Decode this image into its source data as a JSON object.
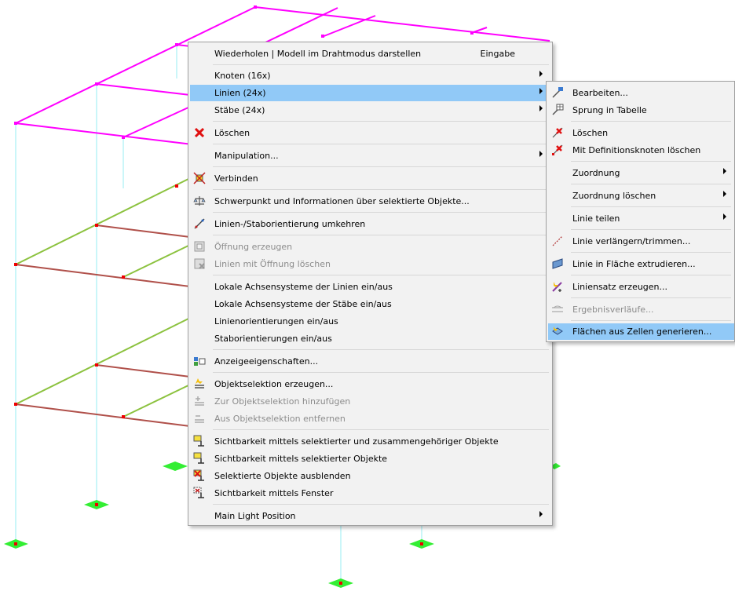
{
  "colors": {
    "roof": "#ff00ff",
    "slab_green": "#8cc23f",
    "slab_brown": "#b0504a",
    "column": "#a8f0f5",
    "support": "#33ee33",
    "node": "#ee0000",
    "highlight": "#91c9f7",
    "menu_bg": "#f2f2f2"
  },
  "context_menu": {
    "items": [
      {
        "label": "Wiederholen | Modell im Drahtmodus darstellen",
        "shortcut": "Eingabe",
        "icon": null
      },
      {
        "label": "Knoten (16x)",
        "submenu": true,
        "icon": null
      },
      {
        "label": "Linien (24x)",
        "submenu": true,
        "highlighted": true,
        "icon": null
      },
      {
        "label": "Stäbe (24x)",
        "submenu": true,
        "icon": null
      },
      {
        "label": "Löschen",
        "icon": "delete-icon"
      },
      {
        "label": "Manipulation...",
        "submenu": true,
        "icon": null
      },
      {
        "label": "Verbinden",
        "icon": "connect-icon"
      },
      {
        "label": "Schwerpunkt und Informationen über selektierte Objekte...",
        "icon": "scales-icon"
      },
      {
        "label": "Linien-/Staborientierung umkehren",
        "icon": "reverse-orientation-icon"
      },
      {
        "label": "Öffnung erzeugen",
        "disabled": true,
        "icon": "opening-create-icon"
      },
      {
        "label": "Linien mit Öffnung löschen",
        "disabled": true,
        "icon": "opening-delete-icon"
      },
      {
        "label": "Lokale Achsensysteme der Linien ein/aus",
        "icon": null
      },
      {
        "label": "Lokale Achsensysteme der Stäbe ein/aus",
        "icon": null
      },
      {
        "label": "Linienorientierungen ein/aus",
        "icon": null
      },
      {
        "label": "Staborientierungen ein/aus",
        "icon": null
      },
      {
        "label": "Anzeigeeigenschaften...",
        "icon": "display-properties-icon"
      },
      {
        "label": "Objektselektion erzeugen...",
        "icon": "selection-create-icon"
      },
      {
        "label": "Zur Objektselektion hinzufügen",
        "disabled": true,
        "icon": "selection-add-icon"
      },
      {
        "label": "Aus Objektselektion entfernen",
        "disabled": true,
        "icon": "selection-remove-icon"
      },
      {
        "label": "Sichtbarkeit mittels selektierter und zusammengehöriger Objekte",
        "icon": "visibility-related-icon"
      },
      {
        "label": "Sichtbarkeit mittels selektierter Objekte",
        "icon": "visibility-selected-icon"
      },
      {
        "label": "Selektierte Objekte ausblenden",
        "icon": "hide-objects-icon"
      },
      {
        "label": "Sichtbarkeit mittels Fenster",
        "icon": "visibility-window-icon"
      },
      {
        "label": "Main Light Position",
        "submenu": true,
        "icon": null
      }
    ]
  },
  "submenu": {
    "items": [
      {
        "label": "Bearbeiten...",
        "icon": "edit-icon"
      },
      {
        "label": "Sprung in Tabelle",
        "icon": "jump-table-icon"
      },
      {
        "label": "Löschen",
        "icon": "delete-icon"
      },
      {
        "label": "Mit Definitionsknoten löschen",
        "icon": "delete-with-nodes-icon"
      },
      {
        "label": "Zuordnung",
        "submenu": true,
        "icon": null
      },
      {
        "label": "Zuordnung löschen",
        "submenu": true,
        "icon": null
      },
      {
        "label": "Linie teilen",
        "submenu": true,
        "icon": null
      },
      {
        "label": "Linie verlängern/trimmen...",
        "icon": "extend-trim-icon"
      },
      {
        "label": "Linie in Fläche extrudieren...",
        "icon": "extrude-icon"
      },
      {
        "label": "Liniensatz erzeugen...",
        "icon": "line-set-icon"
      },
      {
        "label": "Ergebnisverläufe...",
        "disabled": true,
        "icon": "result-diagram-icon"
      },
      {
        "label": "Flächen aus Zellen generieren...",
        "highlighted": true,
        "icon": "surfaces-from-cells-icon"
      }
    ]
  }
}
